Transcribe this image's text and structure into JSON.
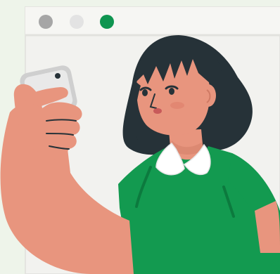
{
  "illustration": {
    "subject": "person-taking-selfie",
    "icons": [
      "window-dot-gray-icon",
      "window-dot-light-icon",
      "window-dot-green-icon",
      "smartphone-icon"
    ]
  },
  "colors": {
    "background": "#eef4ea",
    "window_frame": "#f2f2ef",
    "window_border": "#e4e4e0",
    "dot_gray": "#a6a6a6",
    "dot_light": "#e3e3e3",
    "dot_green": "#0f9550",
    "skin": "#e8957e",
    "skin_shadow": "#cf7a64",
    "hair": "#263238",
    "shirt": "#139a50",
    "shirt_shadow": "#0c7a3e",
    "collar": "#ffffff",
    "phone_body": "#cfcfcf",
    "phone_screen": "#e9e9e9"
  }
}
